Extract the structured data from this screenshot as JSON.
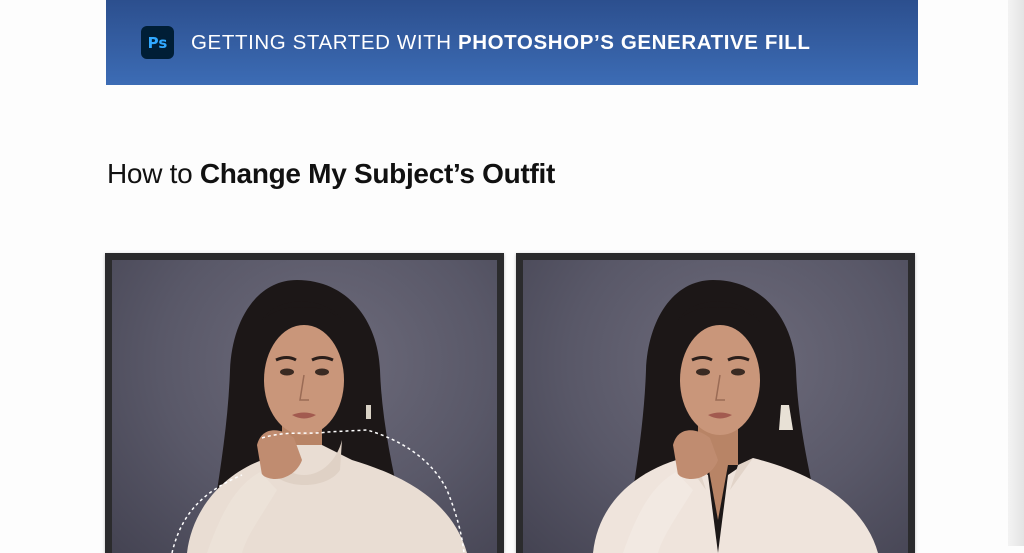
{
  "banner": {
    "logo": "Ps",
    "title_light": "GETTING STARTED WITH ",
    "title_bold": "PHOTOSHOP’S GENERATIVE FILL",
    "colors": {
      "top": "#2c4f8e",
      "bottom": "#3c6cb5",
      "logo_bg": "#001e36",
      "logo_text": "#31a8ff"
    }
  },
  "heading": {
    "light": "How to ",
    "bold": "Change My Subject’s Outfit"
  },
  "images": [
    {
      "name": "before-photo",
      "description_icon": "portrait-sweater-with-selection"
    },
    {
      "name": "after-photo",
      "description_icon": "portrait-blouse"
    }
  ]
}
